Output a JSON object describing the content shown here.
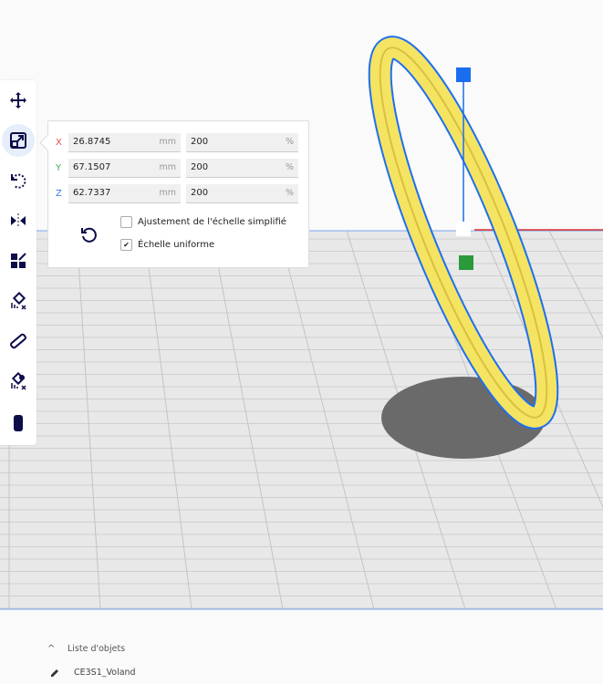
{
  "toolbar": {
    "tools": [
      "move",
      "scale",
      "rotate",
      "mirror",
      "arrange",
      "support-blocker",
      "measure",
      "per-model-settings",
      "cylinder"
    ],
    "active": "scale"
  },
  "scale_panel": {
    "rows": [
      {
        "axis": "X",
        "mm": "26.8745",
        "percent": "200",
        "color": "#e05050"
      },
      {
        "axis": "Y",
        "mm": "67.1507",
        "percent": "200",
        "color": "#3cb050"
      },
      {
        "axis": "Z",
        "mm": "62.7337",
        "percent": "200",
        "color": "#3a7be0"
      }
    ],
    "unit_mm": "mm",
    "unit_percent": "%",
    "snap_scaling_label": "Ajustement de l'échelle simplifié",
    "snap_scaling_checked": false,
    "uniform_label": "Échelle uniforme",
    "uniform_checked": true,
    "checkmark": "✔"
  },
  "object_list": {
    "header": "Liste d'objets",
    "items": [
      "CE3S1_Voland"
    ]
  },
  "colors": {
    "accent": "#196ef0",
    "model": "#f5e462",
    "outline": "#1e6ff0"
  }
}
